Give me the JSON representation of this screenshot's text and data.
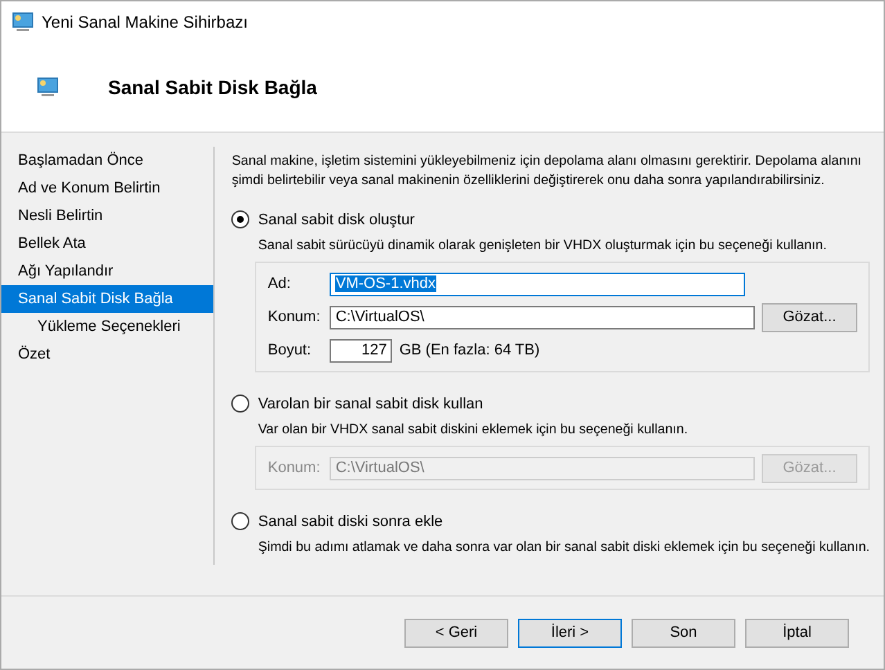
{
  "window": {
    "title": "Yeni Sanal Makine Sihirbazı"
  },
  "header": {
    "title": "Sanal Sabit Disk Bağla"
  },
  "sidebar": {
    "items": [
      {
        "label": "Başlamadan Önce",
        "selected": false
      },
      {
        "label": "Ad ve Konum Belirtin",
        "selected": false
      },
      {
        "label": "Nesli Belirtin",
        "selected": false
      },
      {
        "label": "Bellek Ata",
        "selected": false
      },
      {
        "label": "Ağı Yapılandır",
        "selected": false
      },
      {
        "label": "Sanal Sabit Disk Bağla",
        "selected": true,
        "children": [
          {
            "label": "Yükleme Seçenekleri",
            "selected": false
          }
        ]
      },
      {
        "label": "Özet",
        "selected": false
      }
    ]
  },
  "intro": "Sanal makine, işletim sistemini yükleyebilmeniz için depolama alanı olmasını gerektirir. Depolama alanını şimdi belirtebilir veya sanal makinenin özelliklerini değiştirerek onu daha sonra yapılandırabilirsiniz.",
  "options": [
    {
      "label": "Sanal sabit disk oluştur",
      "selected": true,
      "description": "Sanal sabit sürücüyü dinamik olarak genişleten bir VHDX oluşturmak için bu seçeneği kullanın.",
      "fields": [
        {
          "kind": "text",
          "label": "Ad:",
          "value": "VM-OS-1.vhdx",
          "focused": true
        },
        {
          "kind": "browse",
          "label": "Konum:",
          "value": "C:\\VirtualOS\\",
          "button": "Gözat..."
        },
        {
          "kind": "size",
          "label": "Boyut:",
          "value": "127",
          "unit": "GB (En fazla: 64 TB)"
        }
      ]
    },
    {
      "label": "Varolan bir sanal sabit disk kullan",
      "selected": false,
      "description": "Var olan bir VHDX sanal sabit diskini eklemek için bu seçeneği kullanın.",
      "disabled": true,
      "fields": [
        {
          "kind": "browse",
          "label": "Konum:",
          "value": "C:\\VirtualOS\\",
          "button": "Gözat..."
        }
      ]
    },
    {
      "label": "Sanal sabit diski sonra ekle",
      "selected": false,
      "description": "Şimdi bu adımı atlamak ve daha sonra var olan bir sanal sabit diski eklemek için bu seçeneği kullanın."
    }
  ],
  "buttons": [
    {
      "label": "< Geri",
      "default": false
    },
    {
      "label": "İleri >",
      "default": true
    },
    {
      "label": "Son",
      "default": false
    },
    {
      "label": "İptal",
      "default": false
    }
  ]
}
